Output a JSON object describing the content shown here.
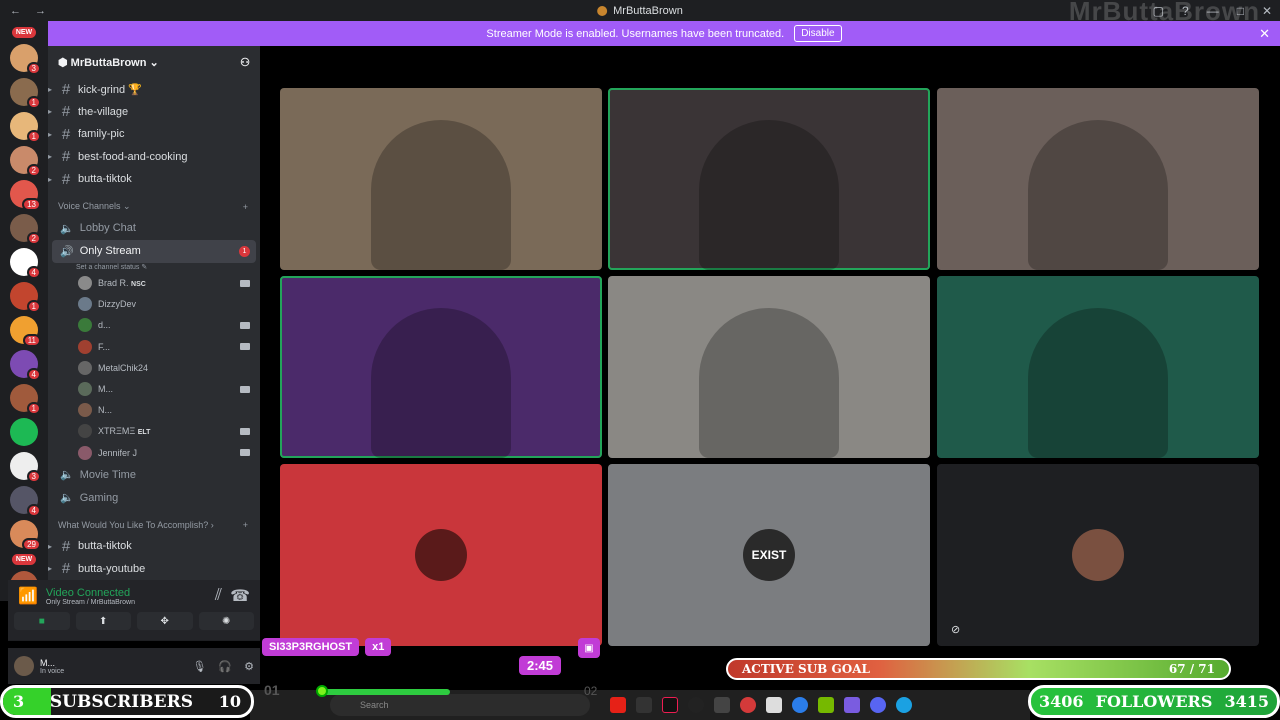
{
  "window": {
    "title": "MrButtaBrown",
    "watermark": "MrButtaBrown"
  },
  "banner": {
    "text": "Streamer Mode is enabled. Usernames have been truncated.",
    "button": "Disable"
  },
  "servers": {
    "new_top": "NEW",
    "new_bottom": "NEW",
    "icons": [
      {
        "color": "#d9a06b",
        "badge": "3"
      },
      {
        "color": "#8a6b4e",
        "badge": "1"
      },
      {
        "color": "#e7b77a",
        "badge": "1"
      },
      {
        "color": "#c98a6a",
        "badge": "2"
      },
      {
        "color": "#e2574c",
        "badge": "13"
      },
      {
        "color": "#7a5c4a",
        "badge": "2"
      },
      {
        "color": "#ffffff",
        "badge": "4"
      },
      {
        "color": "#c2452e",
        "badge": "1"
      },
      {
        "color": "#f0a030",
        "badge": "11"
      },
      {
        "color": "#7d4bb3",
        "badge": "4"
      },
      {
        "color": "#a05a3c",
        "badge": "1"
      },
      {
        "color": "#1db954",
        "badge": ""
      },
      {
        "color": "#eeeeee",
        "badge": "3"
      },
      {
        "color": "#555566",
        "badge": "4"
      },
      {
        "color": "#d98a5a",
        "badge": "29"
      },
      {
        "color": "#b0583c",
        "badge": "23"
      }
    ]
  },
  "sidebar": {
    "guild_name": "MrButtaBrown",
    "text_channels": [
      {
        "label": "kick-grind 🏆"
      },
      {
        "label": "the-village"
      },
      {
        "label": "family-pic"
      },
      {
        "label": "best-food-and-cooking"
      },
      {
        "label": "butta-tiktok"
      }
    ],
    "voice_category": "Voice Channels",
    "lobby": "Lobby Chat",
    "active_voice": "Only Stream",
    "active_badge": "1",
    "status_hint": "Set a channel status",
    "members": [
      {
        "name": "Brad R.",
        "tag": "NSC",
        "color": "#8a8a8a",
        "cam": true
      },
      {
        "name": "DizzyDev",
        "tag": "",
        "color": "#6b7a8a",
        "cam": false
      },
      {
        "name": "d...",
        "tag": "",
        "color": "#3a7a3a",
        "cam": true
      },
      {
        "name": "F...",
        "tag": "",
        "color": "#a04030",
        "cam": true
      },
      {
        "name": "MetalChik24",
        "tag": "",
        "color": "#666666",
        "cam": false
      },
      {
        "name": "M...",
        "tag": "",
        "color": "#5a6a5a",
        "cam": true
      },
      {
        "name": "N...",
        "tag": "",
        "color": "#7a5a4a",
        "cam": false
      },
      {
        "name": "XTRΞMΞ",
        "tag": "ELT",
        "color": "#444444",
        "cam": true
      },
      {
        "name": "Jennifer J",
        "tag": "",
        "color": "#8a5a6a",
        "cam": true
      }
    ],
    "more_voice": [
      "Movie Time",
      "Gaming"
    ],
    "second_category": "What Would You Like To Accomplish?",
    "more_text": [
      {
        "label": "butta-tiktok"
      },
      {
        "label": "butta-youtube"
      }
    ]
  },
  "connection": {
    "status": "Video Connected",
    "channel": "Only Stream / MrButtaBrown"
  },
  "user": {
    "name": "M...",
    "status": "In voice"
  },
  "tiles": [
    {
      "name": "tile-1",
      "bg": "#7a6a58",
      "speaking": false
    },
    {
      "name": "tile-2",
      "bg": "#3a3436",
      "speaking": true
    },
    {
      "name": "tile-3",
      "bg": "#6b5f5a",
      "speaking": false
    },
    {
      "name": "tile-4",
      "bg": "#4b2a6a",
      "speaking": true
    },
    {
      "name": "tile-5",
      "bg": "#8a8884",
      "speaking": false
    },
    {
      "name": "tile-6",
      "bg": "#1f5a4a",
      "speaking": false
    },
    {
      "name": "tile-7",
      "bg": "#c9363b",
      "speaking": false,
      "icon_text": "",
      "icon_bg": "#5a1a1a"
    },
    {
      "name": "tile-8",
      "bg": "#7b7d80",
      "speaking": false,
      "icon_text": "EXIST",
      "icon_bg": "#2a2a2a"
    },
    {
      "name": "tile-9",
      "bg": "#1e1f22",
      "speaking": false,
      "icon_text": "",
      "icon_bg": "#7a5040",
      "muted": true
    }
  ],
  "overlay": {
    "name_tag": "SI33P3RGHOST",
    "multiplier": "x1",
    "timer": "2:45",
    "slider_left": "01",
    "slider_right": "02",
    "goal_label": "ACTIVE SUB GOAL",
    "goal_count": "67 / 71",
    "subs_left": "3",
    "subs_label": "SUBSCRIBERS",
    "subs_right": "10",
    "follow_left": "3406",
    "follow_label": "FOLLOWERS",
    "follow_right": "3415"
  },
  "taskbar": {
    "search_placeholder": "Search"
  }
}
